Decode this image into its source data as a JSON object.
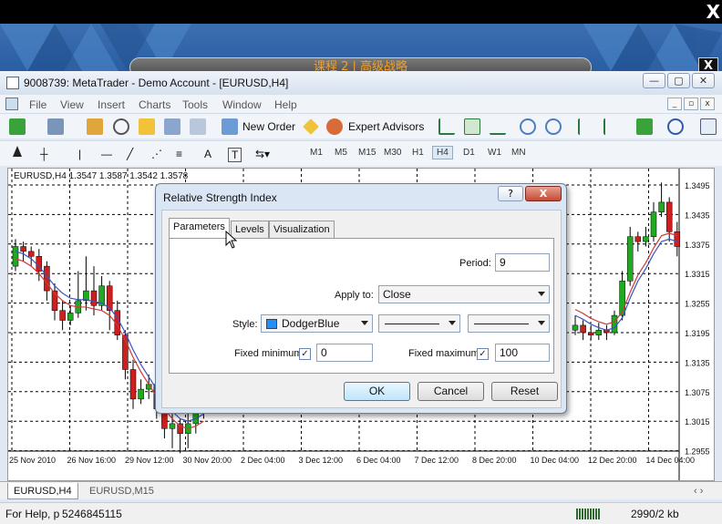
{
  "overlay": {
    "close_label": "X",
    "banner_title": "课程 2 | 高级战略",
    "banner_close": "X"
  },
  "window": {
    "title": "9008739: MetaTrader - Demo Account - [EURUSD,H4]",
    "controls": [
      "—",
      "▢",
      "✕"
    ]
  },
  "menu": {
    "items": [
      "File",
      "View",
      "Insert",
      "Charts",
      "Tools",
      "Window",
      "Help"
    ],
    "mdi_controls": [
      "_",
      "▫",
      "x"
    ]
  },
  "toolbar": {
    "new_order": "New Order",
    "expert_advisors": "Expert Advisors",
    "timeframes": [
      "M1",
      "M5",
      "M15",
      "M30",
      "H1",
      "H4",
      "D1",
      "W1",
      "MN"
    ],
    "active_timeframe": "H4",
    "text_tool": "A",
    "textlabel_tool": "T"
  },
  "chart": {
    "header": "EURUSD,H4  1.3547 1.3587 1.3542 1.3578",
    "price_labels": [
      "1.3495",
      "1.3435",
      "1.3375",
      "1.3315",
      "1.3255",
      "1.3195",
      "1.3135",
      "1.3075",
      "1.3015",
      "1.2955"
    ],
    "time_labels": [
      "25 Nov 2010",
      "26 Nov 16:00",
      "29 Nov 12:00",
      "30 Nov 20:00",
      "2 Dec 04:00",
      "3 Dec 12:00",
      "6 Dec 04:00",
      "7 Dec 12:00",
      "8 Dec 20:00",
      "10 Dec 04:00",
      "12 Dec 20:00",
      "14 Dec 04:00"
    ],
    "colors": {
      "bull": "#1faa1f",
      "bear": "#cc1f1f",
      "ma_blue": "#3b52c4",
      "ma_red": "#cc3a3a",
      "grid": "#000000"
    }
  },
  "chart_tabs": [
    "EURUSD,H4",
    "EURUSD,M15"
  ],
  "statusbar": {
    "help": "For Help, p",
    "id": "5246845115",
    "traffic": "2990/2 kb"
  },
  "dialog": {
    "title": "Relative Strength Index",
    "help_button": "?",
    "close_button": "X",
    "tabs": [
      "Parameters",
      "Levels",
      "Visualization"
    ],
    "period_label": "Period:",
    "period_value": "9",
    "apply_label": "Apply to:",
    "apply_value": "Close",
    "style_label": "Style:",
    "style_color_name": "DodgerBlue",
    "style_color": "#1e90ff",
    "fixed_min_label": "Fixed minimum",
    "fixed_min_value": "0",
    "fixed_max_label": "Fixed maximum",
    "fixed_max_value": "100",
    "check_mark": "✓",
    "ok": "OK",
    "cancel": "Cancel",
    "reset": "Reset"
  }
}
